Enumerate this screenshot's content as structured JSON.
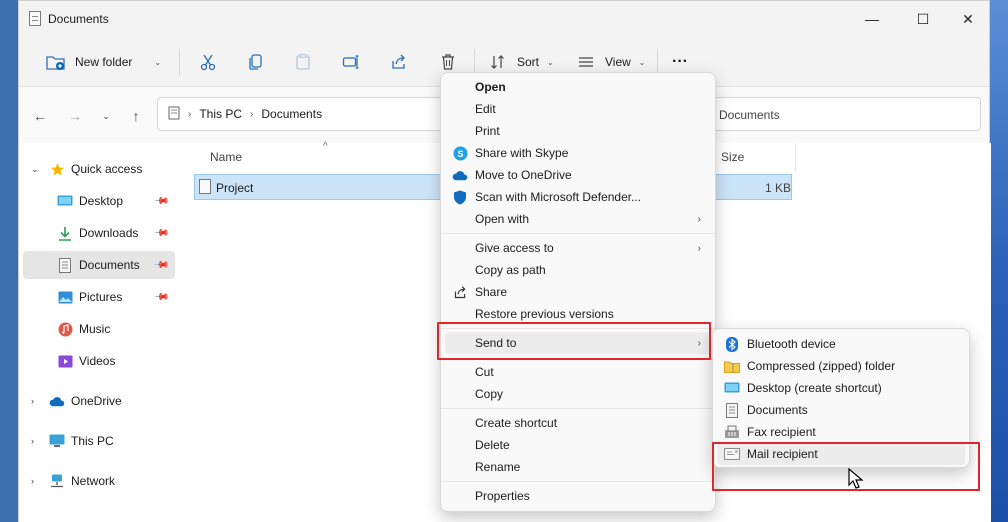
{
  "window": {
    "title": "Documents",
    "minimize_glyph": "—",
    "maximize_glyph": "☐",
    "close_glyph": "✕"
  },
  "toolbar": {
    "new_folder_label": "New folder",
    "sort_label": "Sort",
    "view_label": "View",
    "more_glyph": "···",
    "icons": [
      "new-folder-icon",
      "cut-icon",
      "copy-icon",
      "paste-icon",
      "rename-icon",
      "share-icon",
      "delete-icon",
      "sort-icon",
      "view-icon",
      "more-icon"
    ]
  },
  "address": {
    "crumbs": [
      "This PC",
      "Documents"
    ],
    "search_text": "Documents"
  },
  "sidebar": {
    "items": [
      {
        "label": "Quick access",
        "icon": "star-icon"
      },
      {
        "label": "Desktop",
        "icon": "desktop-icon"
      },
      {
        "label": "Downloads",
        "icon": "download-icon"
      },
      {
        "label": "Documents",
        "icon": "document-icon"
      },
      {
        "label": "Pictures",
        "icon": "pictures-icon"
      },
      {
        "label": "Music",
        "icon": "music-icon"
      },
      {
        "label": "Videos",
        "icon": "videos-icon"
      },
      {
        "label": "OneDrive",
        "icon": "cloud-icon"
      },
      {
        "label": "This PC",
        "icon": "computer-icon"
      },
      {
        "label": "Network",
        "icon": "network-icon"
      }
    ]
  },
  "content": {
    "columns": {
      "name": "Name",
      "size": "Size"
    },
    "files": [
      {
        "name": "Project",
        "size": "1 KB"
      }
    ]
  },
  "context_menu": {
    "open": "Open",
    "edit": "Edit",
    "print": "Print",
    "share_skype": "Share with Skype",
    "move_onedrive": "Move to OneDrive",
    "scan_defender": "Scan with Microsoft Defender...",
    "open_with": "Open with",
    "give_access": "Give access to",
    "copy_path": "Copy as path",
    "share": "Share",
    "restore": "Restore previous versions",
    "send_to": "Send to",
    "cut": "Cut",
    "copy": "Copy",
    "create_shortcut": "Create shortcut",
    "delete": "Delete",
    "rename": "Rename",
    "properties": "Properties"
  },
  "send_to_menu": {
    "bluetooth": "Bluetooth device",
    "compressed": "Compressed (zipped) folder",
    "desktop": "Desktop (create shortcut)",
    "documents": "Documents",
    "fax": "Fax recipient",
    "mail": "Mail recipient"
  },
  "colors": {
    "highlight_box": "#e0262b",
    "selection": "#cce4f7",
    "accent": "#0067c0"
  }
}
